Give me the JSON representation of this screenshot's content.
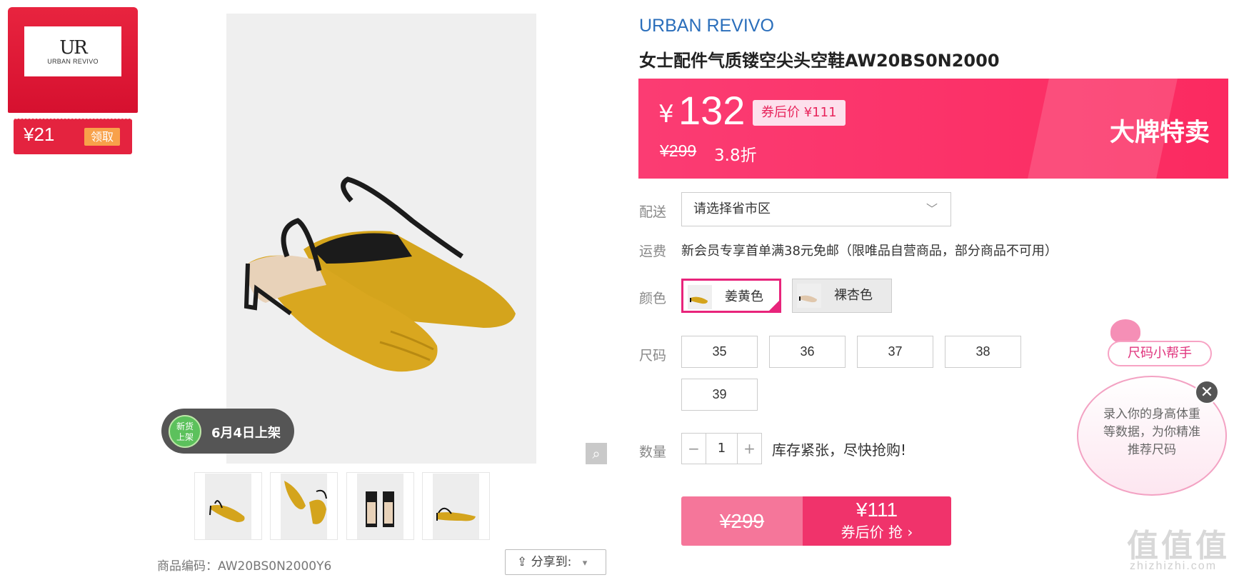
{
  "coupon": {
    "logo_mark": "UR",
    "logo_text": "URBAN REVIVO",
    "value": "¥21",
    "claim_label": "领取"
  },
  "gallery": {
    "badge_circle": "新货\n上架",
    "badge_text": "6月4日上架",
    "zoom_icon": "magnifier-icon",
    "product_code_label": "商品编码：",
    "product_code": "AW20BS0N2000Y6",
    "share_label": "分享到:",
    "share_caret": "▾"
  },
  "product": {
    "brand": "URBAN REVIVO",
    "title": "女士配件气质镂空尖头空鞋AW20BS0N2000"
  },
  "price": {
    "yen": "¥",
    "current": "132",
    "after_coupon": "券后价 ¥111",
    "original": "¥299",
    "discount": "3.8折",
    "promo": "大牌特卖"
  },
  "delivery": {
    "label": "配送",
    "placeholder": "请选择省市区",
    "chevron": "﹀"
  },
  "shipping": {
    "label": "运费",
    "text": "新会员专享首单满38元免邮（限唯品自营商品，部分商品不可用）"
  },
  "colors": {
    "label": "颜色",
    "options": [
      "姜黄色",
      "裸杏色"
    ]
  },
  "sizes": {
    "label": "尺码",
    "options": [
      "35",
      "36",
      "37",
      "38",
      "39"
    ]
  },
  "quantity": {
    "label": "数量",
    "minus": "−",
    "value": "1",
    "plus": "+",
    "stock_note": "库存紧张，尽快抢购!"
  },
  "buy": {
    "original": "¥299",
    "price": "¥111",
    "label": "券后价 抢 ›"
  },
  "size_helper": {
    "title": "尺码小帮手",
    "text": "录入你的身高体重等数据，为你精准推荐尺码",
    "close": "✕"
  },
  "watermark": {
    "main": "值值值",
    "sub": "zhizhizhi.com"
  },
  "colors_theme": {
    "brand_blue": "#2a6ebb",
    "price_pink": "#fb3c73",
    "coupon_red": "#e4233f",
    "badge_green": "#5cc15c"
  }
}
